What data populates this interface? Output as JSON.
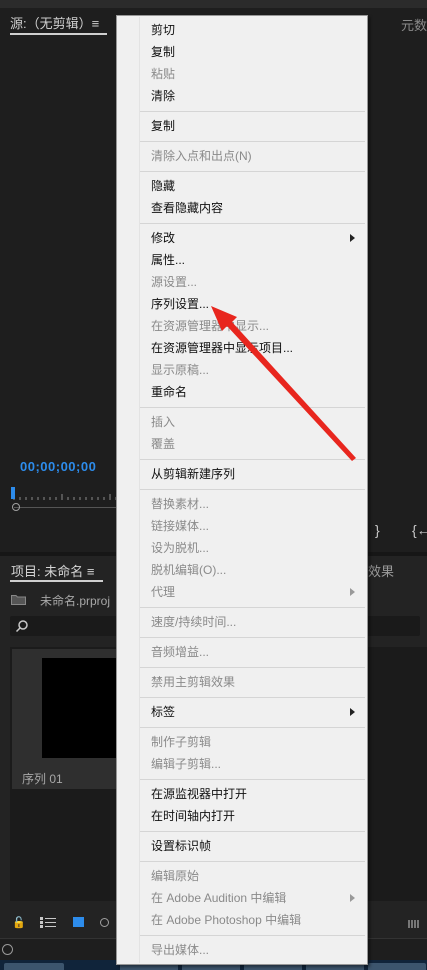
{
  "source_monitor": {
    "tab_label": "源:（无剪辑）≡",
    "meta_tab": "元数",
    "timecode": "00;00;00;00",
    "mark_out_icon": "mark-out-icon",
    "goto_in_icon": "goto-in-icon"
  },
  "project_panel": {
    "tab_label": "项目: 未命名 ≡",
    "effects_tab": "效果",
    "file_name": "未命名.prproj",
    "sequence_name": "序列 01"
  },
  "context_menu": {
    "items": [
      {
        "label": "剪切",
        "enabled": true
      },
      {
        "label": "复制",
        "enabled": true
      },
      {
        "label": "粘贴",
        "enabled": false
      },
      {
        "label": "清除",
        "enabled": true
      },
      {
        "label": "复制",
        "enabled": true
      },
      {
        "label": "清除入点和出点(N)",
        "enabled": false
      },
      {
        "label": "隐藏",
        "enabled": true
      },
      {
        "label": "查看隐藏内容",
        "enabled": true
      },
      {
        "label": "修改",
        "enabled": true,
        "submenu": true
      },
      {
        "label": "属性...",
        "enabled": true
      },
      {
        "label": "源设置...",
        "enabled": false
      },
      {
        "label": "序列设置...",
        "enabled": true
      },
      {
        "label": "在资源管理器中显示...",
        "enabled": false
      },
      {
        "label": "在资源管理器中显示项目...",
        "enabled": true
      },
      {
        "label": "显示原稿...",
        "enabled": false
      },
      {
        "label": "重命名",
        "enabled": true
      },
      {
        "label": "插入",
        "enabled": false
      },
      {
        "label": "覆盖",
        "enabled": false
      },
      {
        "label": "从剪辑新建序列",
        "enabled": true
      },
      {
        "label": "替换素材...",
        "enabled": false
      },
      {
        "label": "链接媒体...",
        "enabled": false
      },
      {
        "label": "设为脱机...",
        "enabled": false
      },
      {
        "label": "脱机编辑(O)...",
        "enabled": false
      },
      {
        "label": "代理",
        "enabled": false,
        "submenu": true
      },
      {
        "label": "速度/持续时间...",
        "enabled": false
      },
      {
        "label": "音频增益...",
        "enabled": false
      },
      {
        "label": "禁用主剪辑效果",
        "enabled": false
      },
      {
        "label": "标签",
        "enabled": true,
        "submenu": true
      },
      {
        "label": "制作子剪辑",
        "enabled": false
      },
      {
        "label": "编辑子剪辑...",
        "enabled": false
      },
      {
        "label": "在源监视器中打开",
        "enabled": true
      },
      {
        "label": "在时间轴内打开",
        "enabled": true
      },
      {
        "label": "设置标识帧",
        "enabled": true
      },
      {
        "label": "编辑原始",
        "enabled": false
      },
      {
        "label": "在 Adobe Audition 中编辑",
        "enabled": false,
        "submenu": true
      },
      {
        "label": "在 Adobe Photoshop 中编辑",
        "enabled": false
      },
      {
        "label": "导出媒体...",
        "enabled": false
      }
    ]
  },
  "colors": {
    "accent": "#2d8ceb",
    "annotation_arrow": "#e8261e",
    "menu_bg": "#f0f0f0"
  }
}
